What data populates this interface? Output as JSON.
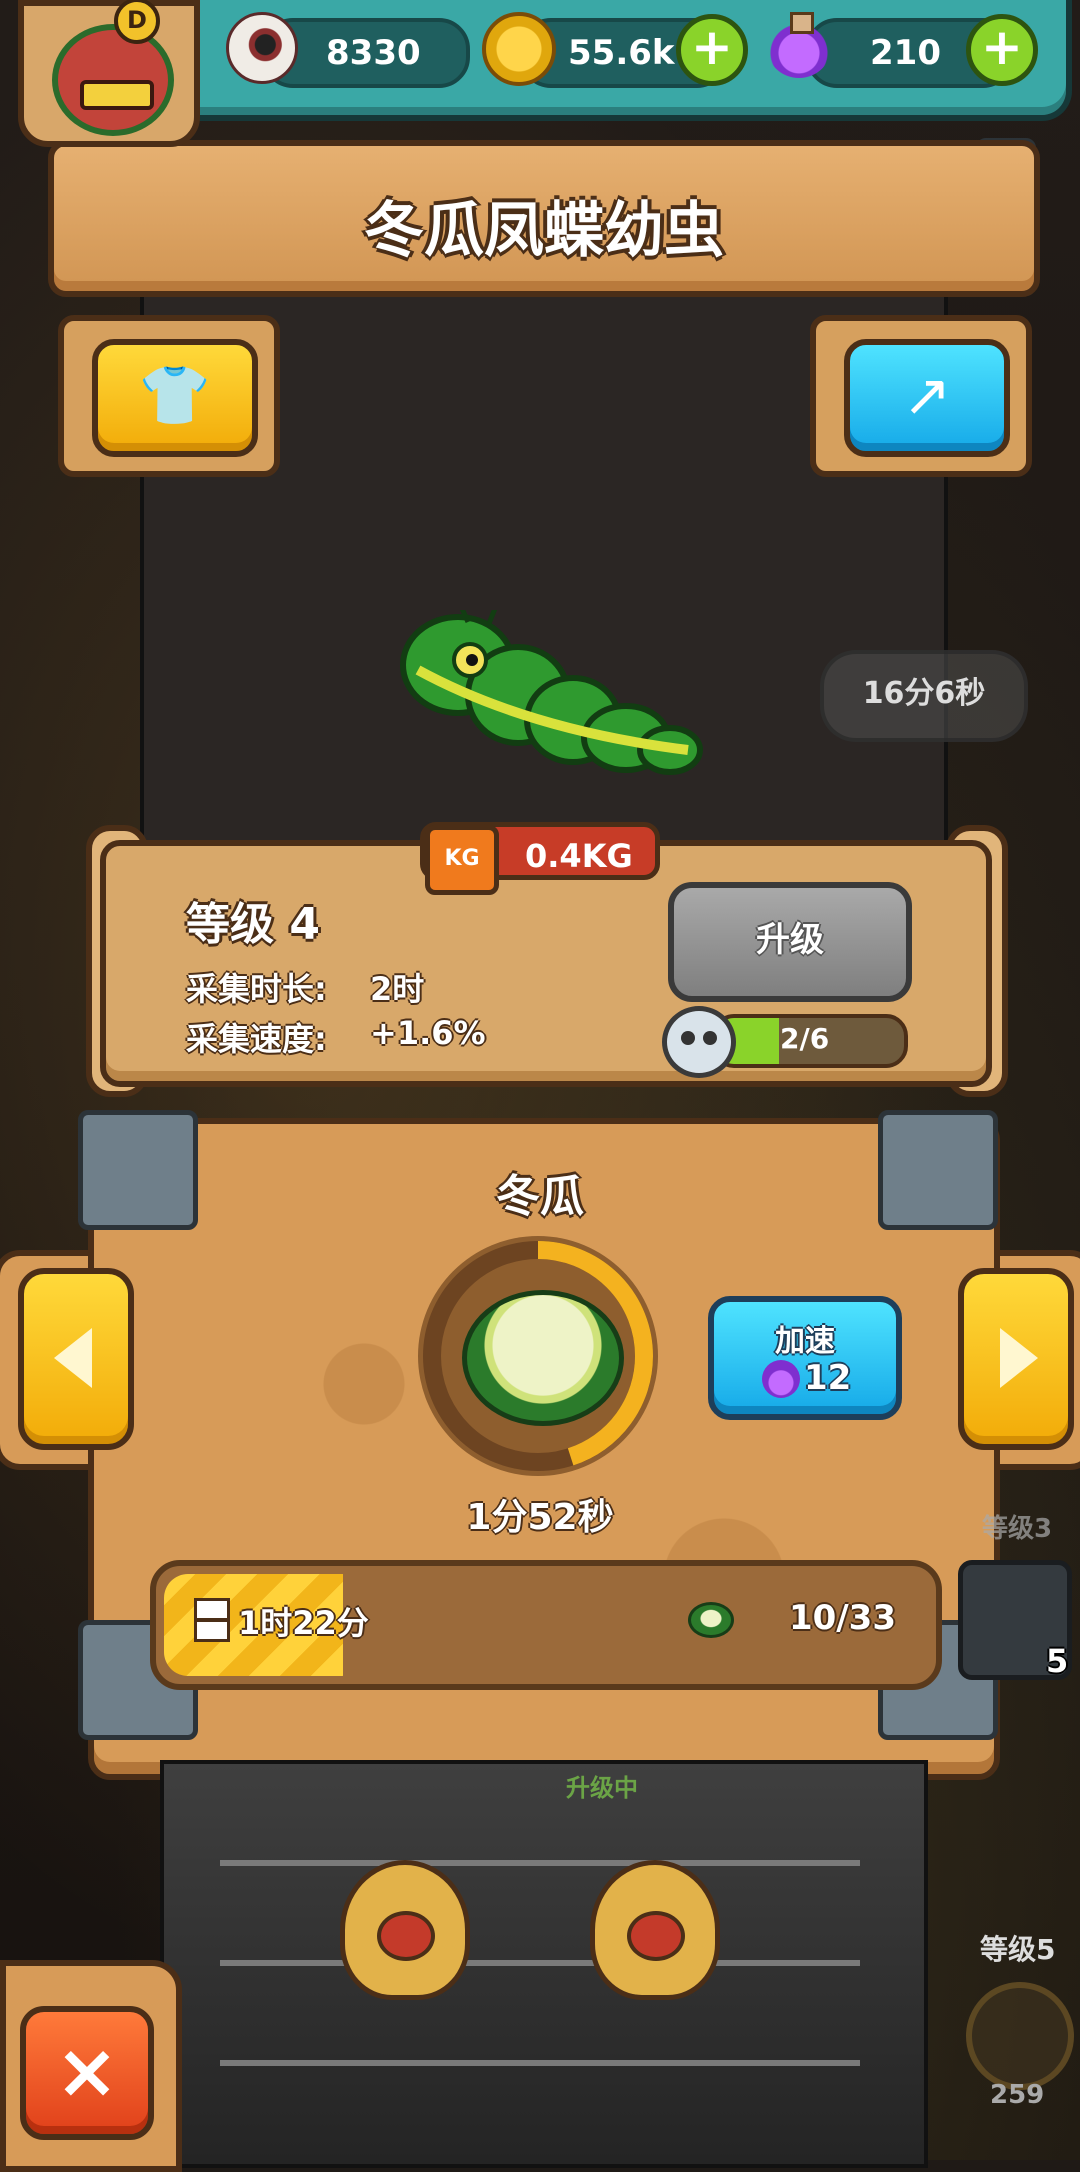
{
  "hud": {
    "eyes": "8330",
    "coins": "55.6k",
    "potions": "210",
    "avatar_badge": "D",
    "plus": "+"
  },
  "title": "冬瓜凤蝶幼虫",
  "scene": {
    "speech_timer": "16分6秒"
  },
  "weight": "0.4KG",
  "weight_icon": "KG",
  "info": {
    "level": "等级 4",
    "collect_duration_label": "采集时长:",
    "collect_duration_value": "2时",
    "collect_speed_label": "采集速度:",
    "collect_speed_value": "+1.6%",
    "upgrade_button": "升级",
    "upgrade_progress_text": "2/6",
    "upgrade_progress": 0.333
  },
  "item": {
    "name": "冬瓜",
    "timer": "1分52秒",
    "ring_progress": 0.45,
    "speed_button": {
      "label": "加速",
      "cost": "12"
    }
  },
  "collection": {
    "remaining_time": "1时22分",
    "count": "10/33",
    "progress": 0.23
  },
  "side_card": {
    "level": "等级3",
    "count": "5"
  },
  "bottom": {
    "upgrading_label": "升级中",
    "level": "等级5",
    "value": "259"
  },
  "icons": {
    "close": "×",
    "shirt": "👕",
    "share": "↗"
  },
  "colors": {
    "accent_teal": "#3aa8a6",
    "wood": "#d79b58",
    "yellow_button": "#f2ab08",
    "cyan_button": "#15a9e8",
    "close_button": "#e0401a"
  }
}
